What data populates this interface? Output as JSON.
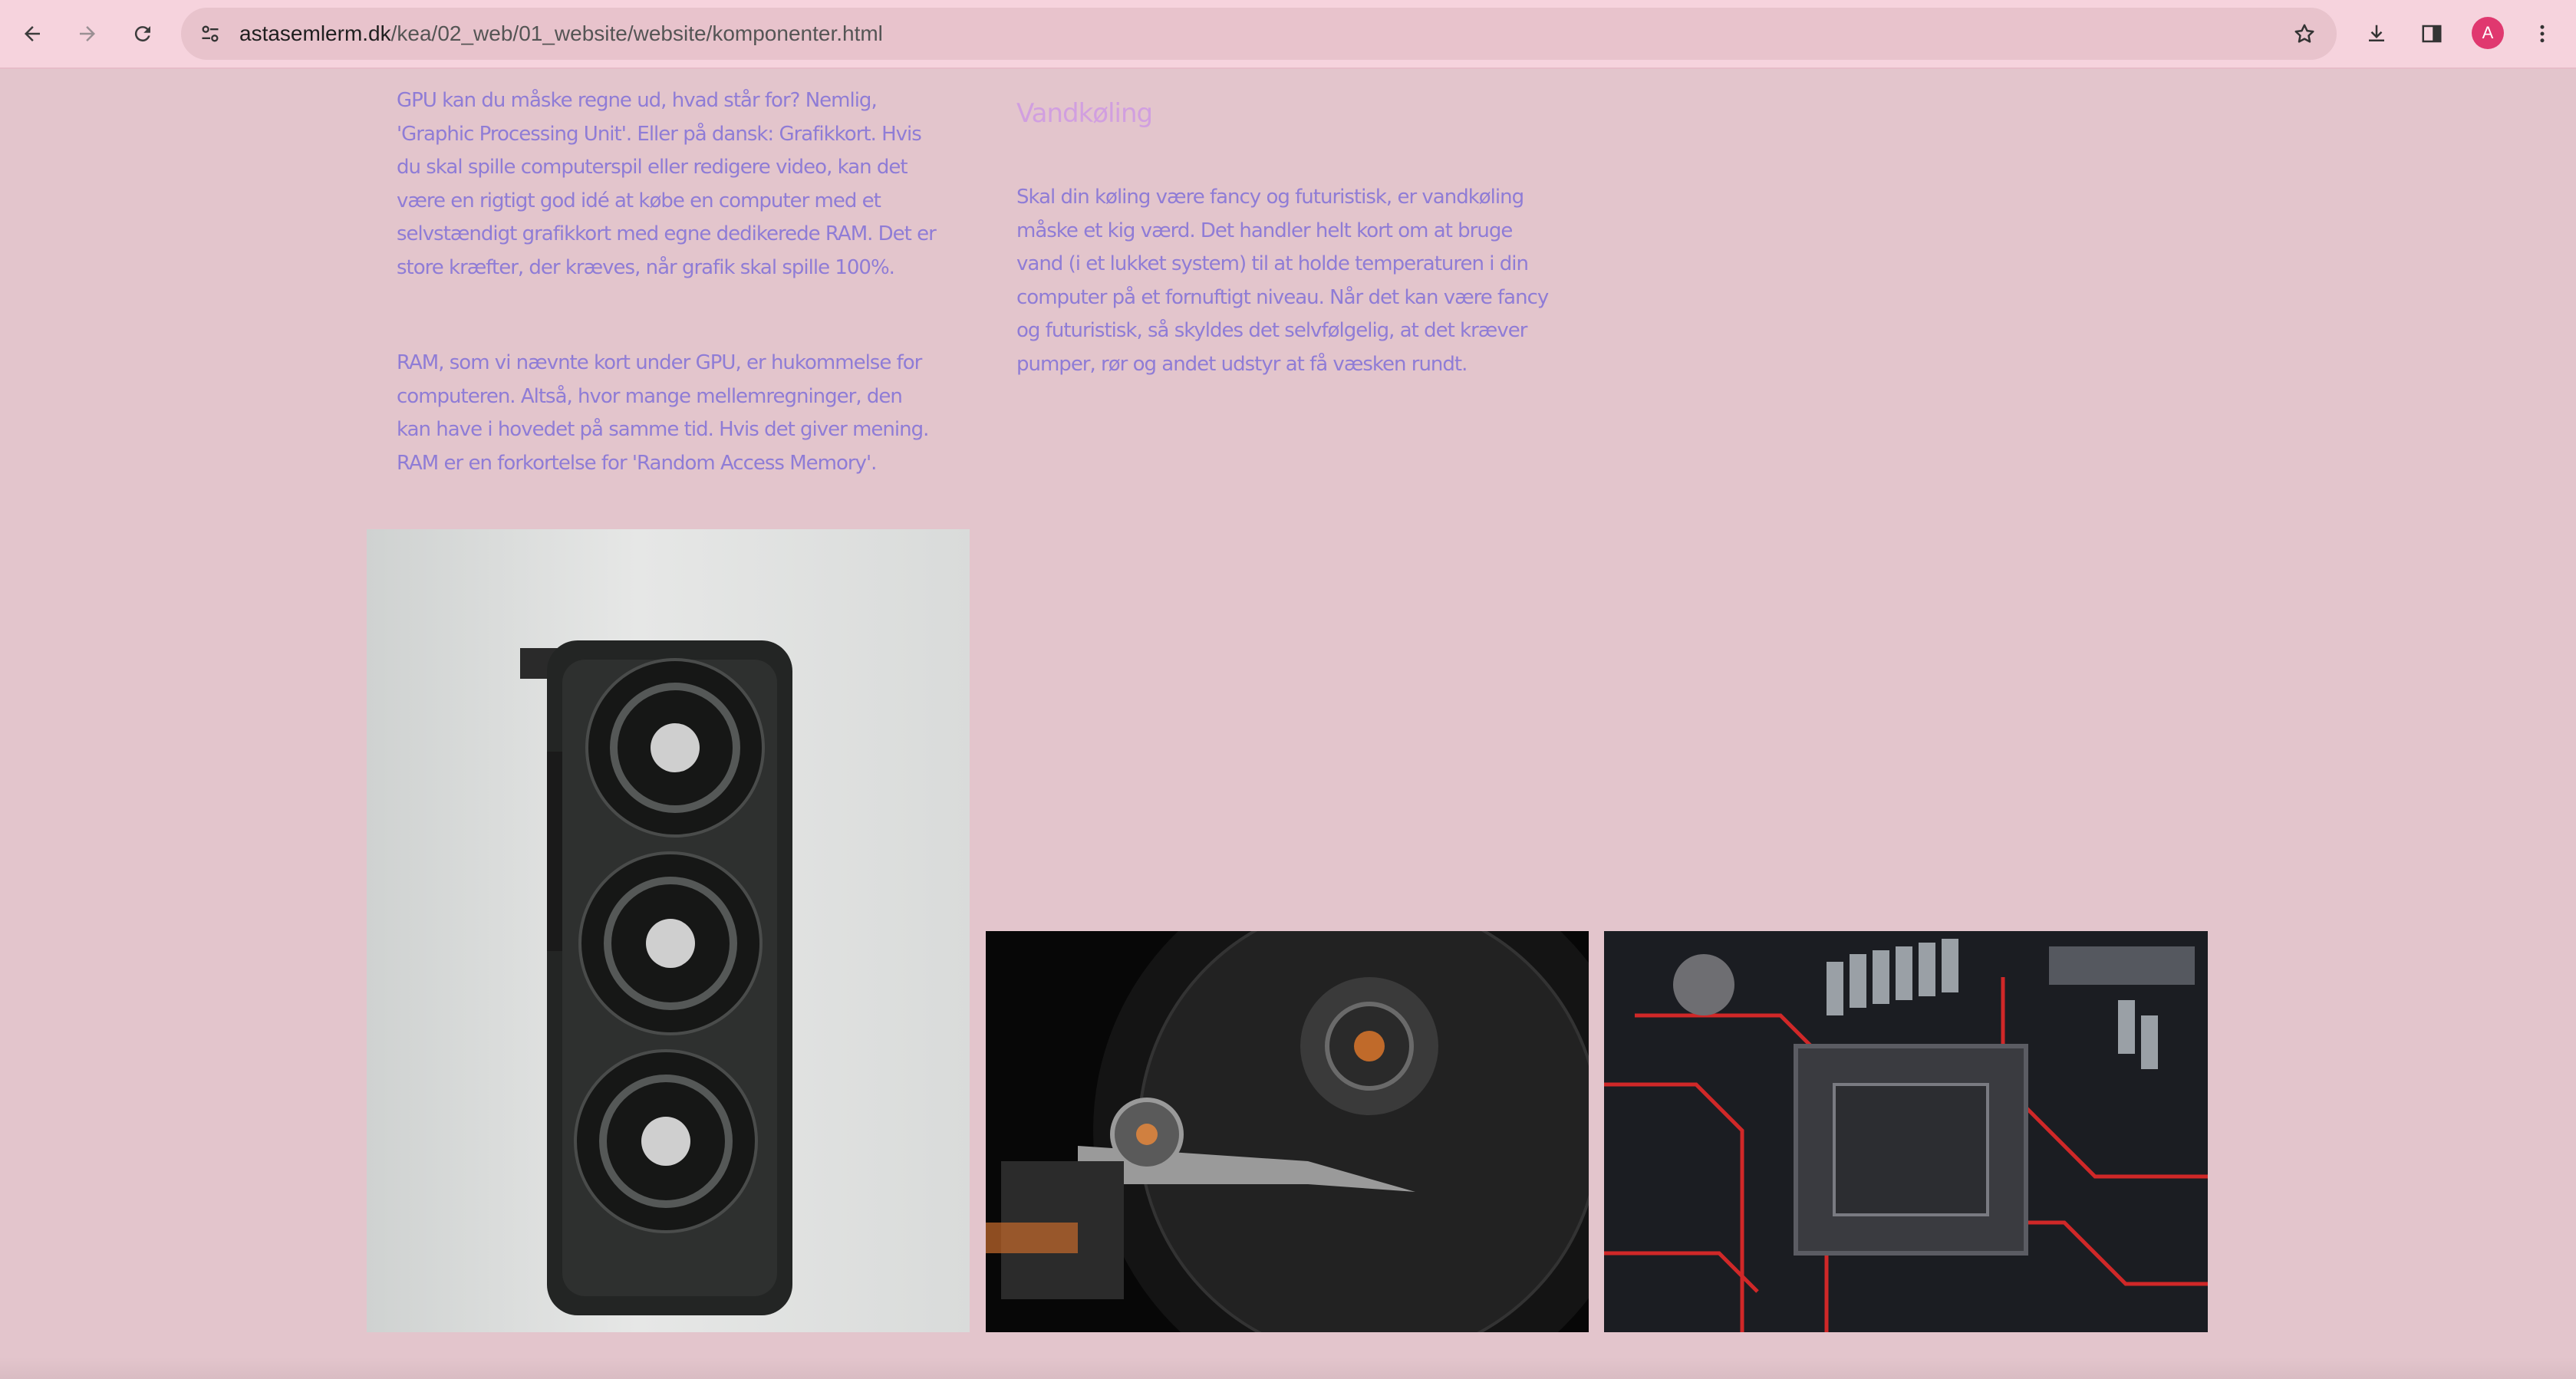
{
  "browser": {
    "url_host": "astasemlerm.dk",
    "url_path": "/kea/02_web/01_website/website/komponenter.html",
    "avatar_letter": "A",
    "icons": {
      "back": "arrow-left-icon",
      "forward": "arrow-right-icon",
      "reload": "reload-icon",
      "site_info": "tune-icon",
      "bookmark": "star-icon",
      "downloads": "download-icon",
      "side_panel": "side-panel-icon",
      "menu": "kebab-menu-icon"
    }
  },
  "page": {
    "gpu_text": "GPU kan du måske regne ud, hvad står for? Nemlig, 'Graphic Processing Unit'. Eller på dansk: Grafikkort. Hvis du skal spille computerspil eller redigere video, kan det være en rigtigt god idé at købe en computer med et selvstændigt grafikkort med egne dedikerede RAM. Det er store kræfter, der kræves, når grafik skal spille 100%.",
    "ram_text": "RAM, som vi nævnte kort under GPU, er hukommelse for computeren. Altså, hvor mange mellemregninger, den kan have i hovedet på samme tid. Hvis det giver mening. RAM er en forkortelse for 'Random Access Memory'.",
    "water_heading": "Vandkøling",
    "water_text": "Skal din køling være fancy og futuristisk, er vandkøling måske et kig værd. Det handler helt kort om at bruge vand (i et lukket system) til at holde temperaturen i din computer på et fornuftigt niveau. Når det kan være fancy og futuristisk, så skyldes det selvfølgelig, at det kræver pumper, rør og andet udstyr at få væsken rundt."
  },
  "colors": {
    "page_bg": "#e3c5cc",
    "toolbar_bg": "#f6d3dd",
    "text": "#8f7cd6",
    "heading": "#d19fe0",
    "avatar": "#e0386f"
  }
}
